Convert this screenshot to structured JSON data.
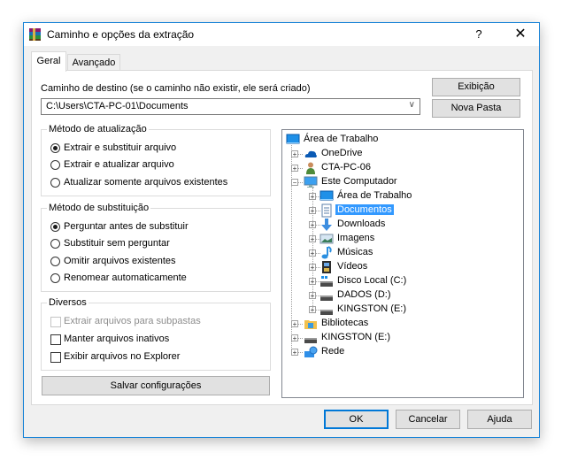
{
  "window": {
    "title": "Caminho e opções da extração",
    "help_label": "?",
    "close_label": "✕",
    "app_icon": "winrar-books-icon"
  },
  "tabs": [
    {
      "label": "Geral",
      "active": true
    },
    {
      "label": "Avançado",
      "active": false
    }
  ],
  "destination": {
    "label": "Caminho de destino (se o caminho não existir, ele será criado)",
    "value": "C:\\Users\\CTA-PC-01\\Documents",
    "dropdown_icon": "chevron-down-icon"
  },
  "buttons": {
    "exibicao": "Exibição",
    "nova_pasta": "Nova Pasta",
    "salvar": "Salvar configurações",
    "ok": "OK",
    "cancelar": "Cancelar",
    "ajuda": "Ajuda"
  },
  "update_method": {
    "title": "Método de atualização",
    "options": [
      {
        "label": "Extrair e substituir arquivo",
        "checked": true
      },
      {
        "label": "Extrair e atualizar arquivo",
        "checked": false
      },
      {
        "label": "Atualizar somente arquivos existentes",
        "checked": false
      }
    ]
  },
  "overwrite_method": {
    "title": "Método de substituição",
    "options": [
      {
        "label": "Perguntar antes de substituir",
        "checked": true
      },
      {
        "label": "Substituir sem perguntar",
        "checked": false
      },
      {
        "label": "Omitir arquivos existentes",
        "checked": false
      },
      {
        "label": "Renomear automaticamente",
        "checked": false
      }
    ]
  },
  "misc": {
    "title": "Diversos",
    "options": [
      {
        "label": "Extrair arquivos para subpastas",
        "checked": false,
        "disabled": true
      },
      {
        "label": "Manter arquivos inativos",
        "checked": false,
        "disabled": false
      },
      {
        "label": "Exibir arquivos no Explorer",
        "checked": false,
        "disabled": false
      }
    ]
  },
  "tree": {
    "nodes": [
      {
        "label": "Área de Trabalho",
        "icon": "desktop-icon",
        "level": 0,
        "expander": "none"
      },
      {
        "label": "OneDrive",
        "icon": "onedrive-cloud-icon",
        "level": 1,
        "expander": "+"
      },
      {
        "label": "CTA-PC-06",
        "icon": "user-icon",
        "level": 1,
        "expander": "+"
      },
      {
        "label": "Este Computador",
        "icon": "computer-icon",
        "level": 1,
        "expander": "-"
      },
      {
        "label": "Área de Trabalho",
        "icon": "desktop-icon",
        "level": 2,
        "expander": "+"
      },
      {
        "label": "Documentos",
        "icon": "documents-icon",
        "level": 2,
        "expander": "+",
        "selected": true
      },
      {
        "label": "Downloads",
        "icon": "downloads-arrow-icon",
        "level": 2,
        "expander": "+"
      },
      {
        "label": "Imagens",
        "icon": "pictures-icon",
        "level": 2,
        "expander": "+"
      },
      {
        "label": "Músicas",
        "icon": "music-note-icon",
        "level": 2,
        "expander": "+"
      },
      {
        "label": "Vídeos",
        "icon": "videos-film-icon",
        "level": 2,
        "expander": "+"
      },
      {
        "label": "Disco Local (C:)",
        "icon": "system-drive-icon",
        "level": 2,
        "expander": "+"
      },
      {
        "label": "DADOS (D:)",
        "icon": "drive-icon",
        "level": 2,
        "expander": "+"
      },
      {
        "label": "KINGSTON (E:)",
        "icon": "drive-icon",
        "level": 2,
        "expander": "+"
      },
      {
        "label": "Bibliotecas",
        "icon": "libraries-folder-icon",
        "level": 1,
        "expander": "+"
      },
      {
        "label": "KINGSTON (E:)",
        "icon": "drive-icon",
        "level": 1,
        "expander": "+"
      },
      {
        "label": "Rede",
        "icon": "network-icon",
        "level": 1,
        "expander": "+"
      }
    ]
  },
  "colors": {
    "accent": "#1883d7",
    "selection": "#3399ff",
    "window_bg": "#f0f0f0"
  }
}
